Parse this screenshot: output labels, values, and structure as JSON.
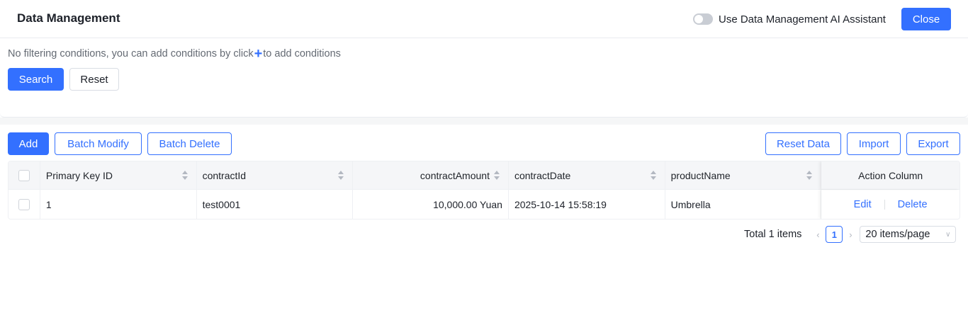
{
  "header": {
    "title": "Data Management",
    "ai_toggle_label": "Use Data Management AI Assistant",
    "ai_toggle_on": false,
    "close_label": "Close"
  },
  "filter": {
    "hint_before": "No filtering conditions, you can add conditions by click",
    "hint_after": "to add conditions",
    "search_label": "Search",
    "reset_label": "Reset"
  },
  "toolbar": {
    "add_label": "Add",
    "batch_modify_label": "Batch Modify",
    "batch_delete_label": "Batch Delete",
    "reset_data_label": "Reset Data",
    "import_label": "Import",
    "export_label": "Export"
  },
  "table": {
    "columns": {
      "pk": "Primary Key ID",
      "contract_id": "contractId",
      "contract_amount": "contractAmount",
      "contract_date": "contractDate",
      "product_name": "productName",
      "action": "Action Column"
    },
    "rows": [
      {
        "pk": "1",
        "contract_id": "test0001",
        "contract_amount": "10,000.00 Yuan",
        "contract_date": "2025-10-14 15:58:19",
        "product_name": "Umbrella",
        "edit_label": "Edit",
        "delete_label": "Delete"
      }
    ]
  },
  "pagination": {
    "total_text": "Total 1 items",
    "current_page": "1",
    "page_size_label": "20 items/page"
  },
  "colors": {
    "primary": "#3370ff",
    "text": "#1d2129",
    "muted": "#646a73"
  }
}
